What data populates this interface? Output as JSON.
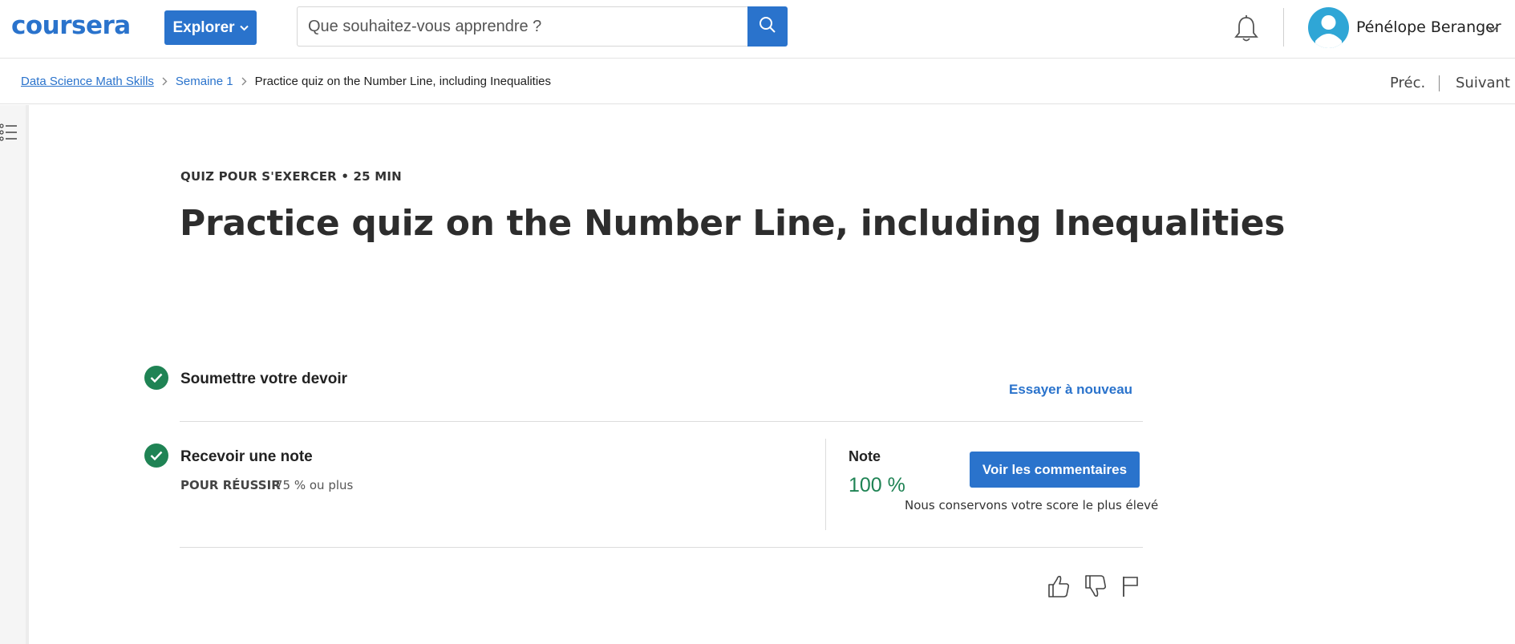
{
  "header": {
    "logo_text": "coursera",
    "explore_label": "Explorer",
    "search_placeholder": "Que souhaitez-vous apprendre ?",
    "user_name": "Pénélope Beranger"
  },
  "breadcrumb": {
    "items": [
      "Data Science Math Skills",
      "Semaine 1",
      "Practice quiz on the Number Line, including Inequalities"
    ],
    "prev_label": "Préc.",
    "next_label": "Suivant"
  },
  "quiz": {
    "eyebrow": "QUIZ POUR S'EXERCER • 25  MIN",
    "title": "Practice quiz on the Number Line, including Inequalities",
    "submit_step": {
      "title": "Soumettre votre devoir",
      "action_label": "Essayer à nouveau"
    },
    "grade_step": {
      "title": "Recevoir une note",
      "pass_label": "POUR RÉUSSIR",
      "pass_value": "75 % ou plus",
      "grade_label": "Note",
      "grade_value": "100 %",
      "feedback_label": "Voir les commentaires",
      "keep_note": "Nous conservons votre score le plus élevé"
    }
  },
  "colors": {
    "accent": "#2a73cc",
    "success": "#1f8354",
    "avatar": "#2fa6d6"
  },
  "icons": [
    "search-icon",
    "bell-icon",
    "user-avatar-icon",
    "chevron-down-icon",
    "course-outline-icon",
    "check-icon",
    "thumbs-up-icon",
    "thumbs-down-icon",
    "flag-icon"
  ]
}
